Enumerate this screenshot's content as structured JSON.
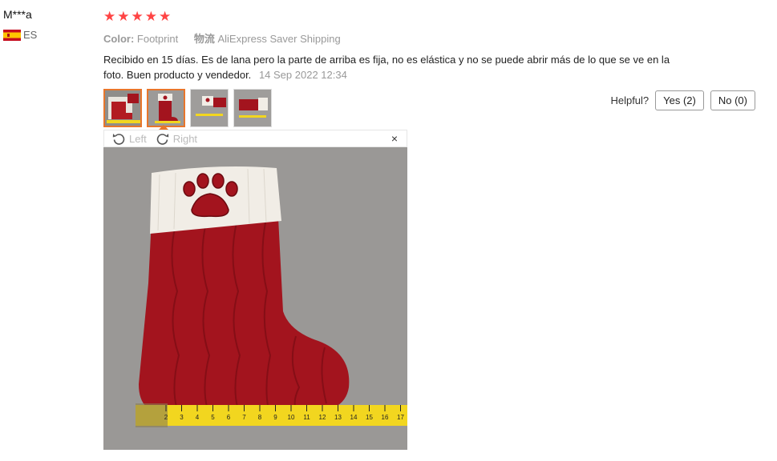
{
  "user": {
    "name": "M***a",
    "country": "ES"
  },
  "review": {
    "rating": 5,
    "stars": [
      "★",
      "★",
      "★",
      "★",
      "★"
    ],
    "color_label": "Color:",
    "color_value": "Footprint",
    "shipping_label": "物流",
    "shipping_value": "AliExpress Saver Shipping",
    "text": "Recibido en 15 días. Es de lana pero la parte de arriba es fija, no es elástica y no se puede abrir más de lo que se ve en la foto. Buen producto y vendedor.",
    "date": "14 Sep 2022 12:34"
  },
  "helpful": {
    "label": "Helpful?",
    "yes": "Yes (2)",
    "no": "No (0)"
  },
  "viewer": {
    "left_label": "Left",
    "right_label": "Right",
    "close": "×",
    "selected_index": 1
  },
  "ruler_ticks": [
    "2",
    "3",
    "4",
    "5",
    "6",
    "7",
    "8",
    "9",
    "10",
    "11",
    "12",
    "13",
    "14",
    "15",
    "16",
    "17"
  ],
  "colors": {
    "star": "#ff4747",
    "accent": "#e8762c",
    "stocking": "#a3141e",
    "cuff": "#f1ede6",
    "ruler": "#f2d61f"
  }
}
